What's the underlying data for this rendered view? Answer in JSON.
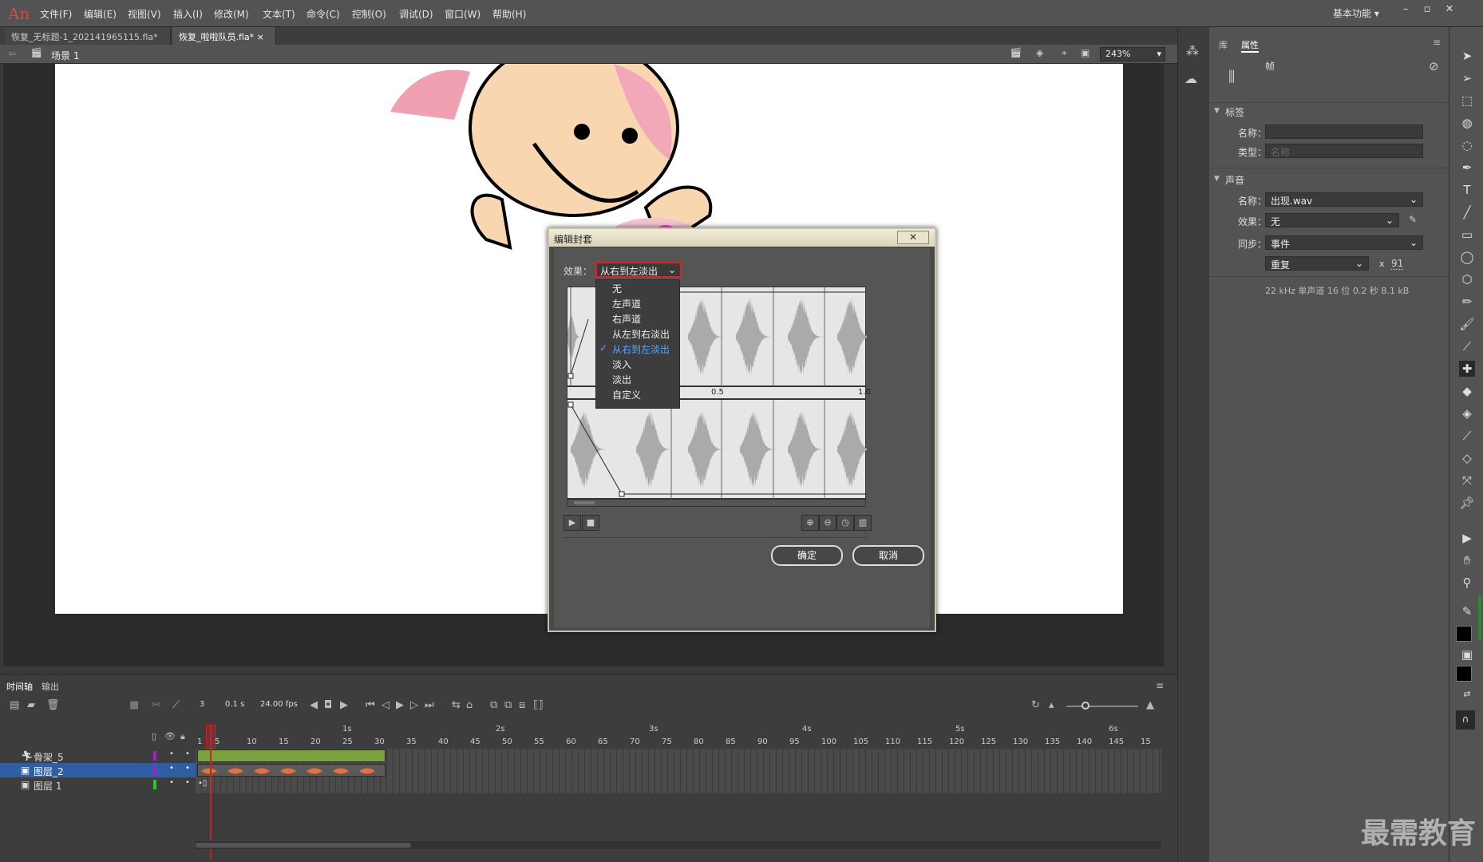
{
  "app": {
    "logo": "An"
  },
  "menu": [
    "文件(F)",
    "编辑(E)",
    "视图(V)",
    "插入(I)",
    "修改(M)",
    "文本(T)",
    "命令(C)",
    "控制(O)",
    "调试(D)",
    "窗口(W)",
    "帮助(H)"
  ],
  "workspace": "基本功能",
  "tabs": [
    {
      "label": "恢复_无标题-1_202141965115.fla*"
    },
    {
      "label": "恢复_啦啦队员.fla*"
    }
  ],
  "scene": {
    "label": "场景 1",
    "zoom": "243%"
  },
  "properties": {
    "tab_library": "库",
    "tab_properties": "属性",
    "frame_label": "帧",
    "section_label": "标签",
    "name_label": "名称：",
    "name_placeholder": "",
    "type_label": "类型：",
    "type_value": "名称",
    "section_sound": "声音",
    "sound_name_label": "名称：",
    "sound_name_value": "出现.wav",
    "effect_label": "效果：",
    "effect_value": "无",
    "sync_label": "同步：",
    "sync_value": "事件",
    "repeat_value": "重复",
    "repeat_x": "x",
    "repeat_count": "91",
    "sound_info": "22 kHz 单声道 16 位 0.2 秒 8.1 kB"
  },
  "dialog": {
    "title": "编辑封套",
    "close": "✕",
    "effect_label": "效果：",
    "effect_value": "从右到左淡出",
    "options": [
      "无",
      "左声道",
      "右声道",
      "从左到右淡出",
      "从右到左淡出",
      "淡入",
      "淡出",
      "自定义"
    ],
    "checked_index": 4,
    "ruler_labels": [
      "0.5",
      "1.0"
    ],
    "ok": "确定",
    "cancel": "取消"
  },
  "timeline": {
    "tab_timeline": "时间轴",
    "tab_output": "输出",
    "current_frame": "3",
    "elapsed": "0.1 s",
    "fps": "24.00 fps",
    "seconds_marks": [
      "1s",
      "2s",
      "3s",
      "4s",
      "5s",
      "6s"
    ],
    "frame_numbers": [
      "1",
      "5",
      "10",
      "15",
      "20",
      "25",
      "30",
      "35",
      "40",
      "45",
      "50",
      "55",
      "60",
      "65",
      "70",
      "75",
      "80",
      "85",
      "90",
      "95",
      "100",
      "105",
      "110",
      "115",
      "120",
      "125",
      "130",
      "135",
      "140",
      "145",
      "15"
    ],
    "layers": [
      {
        "name": "骨架_5",
        "color": "#a020d0",
        "selected": false
      },
      {
        "name": "图层_2",
        "color": "#a020d0",
        "selected": true
      },
      {
        "name": "图层 1",
        "color": "#22cc22",
        "selected": false
      }
    ]
  },
  "watermark": "最需教育",
  "colors": {
    "accent": "#2e5fa3",
    "frame_green": "#7aa23e",
    "wave_orange": "#e8703a",
    "playhead": "#d02020"
  }
}
